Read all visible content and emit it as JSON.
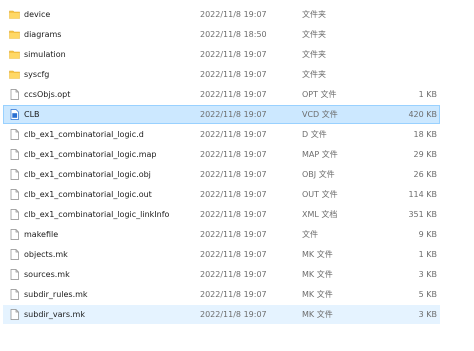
{
  "files": [
    {
      "name": "device",
      "date": "2022/11/8 19:07",
      "type": "文件夹",
      "size": "",
      "icon": "folder-icon"
    },
    {
      "name": "diagrams",
      "date": "2022/11/8 18:50",
      "type": "文件夹",
      "size": "",
      "icon": "folder-icon"
    },
    {
      "name": "simulation",
      "date": "2022/11/8 19:07",
      "type": "文件夹",
      "size": "",
      "icon": "folder-icon"
    },
    {
      "name": "syscfg",
      "date": "2022/11/8 19:07",
      "type": "文件夹",
      "size": "",
      "icon": "folder-icon"
    },
    {
      "name": "ccsObjs.opt",
      "date": "2022/11/8 19:07",
      "type": "OPT 文件",
      "size": "1 KB",
      "icon": "file-icon"
    },
    {
      "name": "CLB",
      "date": "2022/11/8 19:07",
      "type": "VCD 文件",
      "size": "420 KB",
      "icon": "vcd-file-icon",
      "selected": true
    },
    {
      "name": "clb_ex1_combinatorial_logic.d",
      "date": "2022/11/8 19:07",
      "type": "D 文件",
      "size": "18 KB",
      "icon": "file-icon"
    },
    {
      "name": "clb_ex1_combinatorial_logic.map",
      "date": "2022/11/8 19:07",
      "type": "MAP 文件",
      "size": "29 KB",
      "icon": "file-icon"
    },
    {
      "name": "clb_ex1_combinatorial_logic.obj",
      "date": "2022/11/8 19:07",
      "type": "OBJ 文件",
      "size": "26 KB",
      "icon": "file-icon"
    },
    {
      "name": "clb_ex1_combinatorial_logic.out",
      "date": "2022/11/8 19:07",
      "type": "OUT 文件",
      "size": "114 KB",
      "icon": "file-icon"
    },
    {
      "name": "clb_ex1_combinatorial_logic_linkInfo",
      "date": "2022/11/8 19:07",
      "type": "XML 文档",
      "size": "351 KB",
      "icon": "file-icon"
    },
    {
      "name": "makefile",
      "date": "2022/11/8 19:07",
      "type": "文件",
      "size": "9 KB",
      "icon": "file-icon"
    },
    {
      "name": "objects.mk",
      "date": "2022/11/8 19:07",
      "type": "MK 文件",
      "size": "1 KB",
      "icon": "file-icon"
    },
    {
      "name": "sources.mk",
      "date": "2022/11/8 19:07",
      "type": "MK 文件",
      "size": "3 KB",
      "icon": "file-icon"
    },
    {
      "name": "subdir_rules.mk",
      "date": "2022/11/8 19:07",
      "type": "MK 文件",
      "size": "5 KB",
      "icon": "file-icon"
    },
    {
      "name": "subdir_vars.mk",
      "date": "2022/11/8 19:07",
      "type": "MK 文件",
      "size": "3 KB",
      "icon": "file-icon",
      "hover": true
    }
  ]
}
